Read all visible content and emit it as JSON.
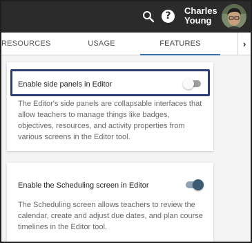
{
  "header": {
    "user_name": "Charles Young",
    "search_icon": "search-icon",
    "help_icon": "help-icon"
  },
  "tabs": [
    {
      "label": "RESOURCES"
    },
    {
      "label": "USAGE"
    },
    {
      "label": "FEATURES",
      "active": true
    }
  ],
  "tabs_next_icon": "chevron-right-icon",
  "features": [
    {
      "title": "Enable side panels in Editor",
      "description": "The Editor's side panels are collapsable interfaces that allow teachers to manage things like badges, objectives, resources, and activity properties from various screens in the Editor tool.",
      "enabled": false
    },
    {
      "title": "Enable the Scheduling screen in Editor",
      "description": "The Scheduling screen allows teachers to review the calendar, create and adjust due dates, and plan course timelines in the Editor tool.",
      "enabled": true
    }
  ],
  "colors": {
    "header_bg": "#2b2b2b",
    "tab_indicator": "#2e74b5",
    "highlight_border": "#2c3e73",
    "toggle_on": "#3d5a73"
  }
}
